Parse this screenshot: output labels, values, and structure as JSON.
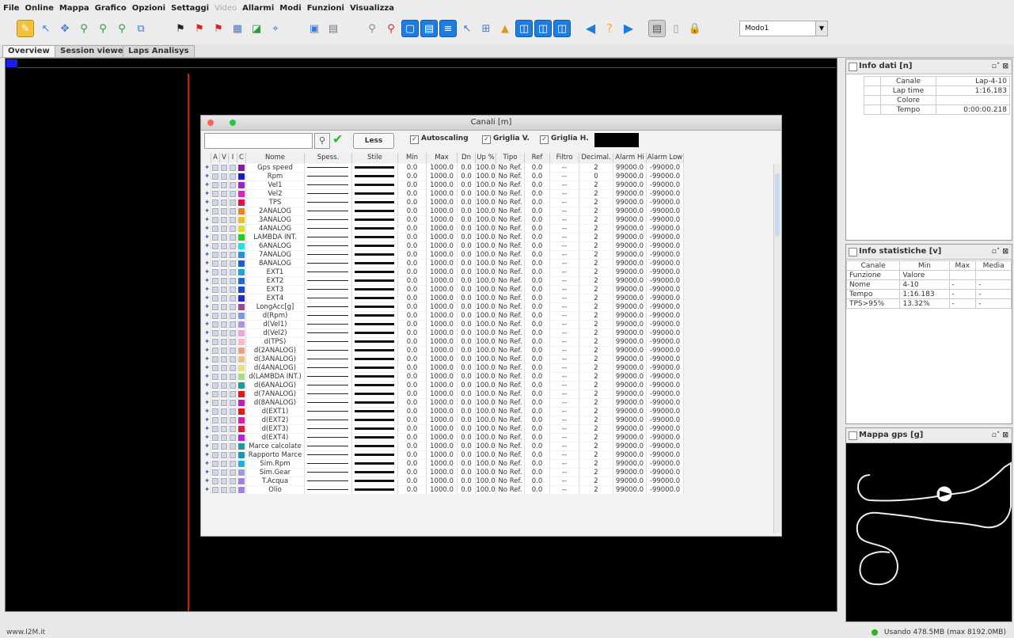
{
  "menu": [
    "File",
    "Online",
    "Mappa",
    "Grafico",
    "Opzioni",
    "Settaggi",
    "Video",
    "Allarmi",
    "Modi",
    "Funzioni",
    "Visualizza"
  ],
  "menu_disabled": [
    "Video"
  ],
  "toolbar": {
    "mode_value": "Modo1"
  },
  "tabs": [
    "Overview",
    "Session viewer",
    "Laps Analisys"
  ],
  "active_tab": "Overview",
  "status": {
    "website": "www.I2M.it",
    "memory": "Usando 478.5MB (max 8192.0MB)"
  },
  "info_dati": {
    "title": "Info dati [n]",
    "rows": [
      {
        "label": "Canale",
        "value": "Lap-4-10"
      },
      {
        "label": "Lap time",
        "value": "1:16.183"
      },
      {
        "label": "Colore",
        "value": ""
      },
      {
        "label": "Tempo",
        "value": "0:00:00.218"
      }
    ]
  },
  "info_stat": {
    "title": "Info statistiche [v]",
    "headers": [
      "Canale",
      "Min",
      "Max",
      "Media"
    ],
    "rows": [
      [
        "Funzione",
        "Valore",
        "",
        ""
      ],
      [
        "Nome",
        "4-10",
        "-",
        "-"
      ],
      [
        "Tempo",
        "1:16.183",
        "-",
        "-"
      ],
      [
        "TPS>95%",
        "13.32%",
        "-",
        "-"
      ]
    ]
  },
  "mappa_gps": {
    "title": "Mappa gps [g]"
  },
  "dialog": {
    "title": "Canali [m]",
    "less_label": "Less",
    "autoscaling": "Autoscaling",
    "griglia_v": "Griglia V.",
    "griglia_h": "Griglia H.",
    "headers": [
      "A",
      "V",
      "I",
      "C",
      "Nome",
      "Spess.",
      "Stile",
      "Min",
      "Max",
      "Dn %",
      "Up %",
      "Tipo",
      "Ref",
      "Filtro",
      "Decimal.",
      "Alarm Hi",
      "Alarm Low"
    ],
    "rows": [
      {
        "name": "Gps speed",
        "color": "#8a1a9a",
        "dec": "2"
      },
      {
        "name": "Rpm",
        "color": "#1a1acc",
        "dec": "0"
      },
      {
        "name": "Vel1",
        "color": "#a020d0",
        "dec": "2"
      },
      {
        "name": "Vel2",
        "color": "#e020c0",
        "dec": "2"
      },
      {
        "name": "TPS",
        "color": "#e0104a",
        "dec": "2"
      },
      {
        "name": "2ANALOG",
        "color": "#f08020",
        "dec": "2"
      },
      {
        "name": "3ANALOG",
        "color": "#f0c020",
        "dec": "2"
      },
      {
        "name": "4ANALOG",
        "color": "#d8e020",
        "dec": "2"
      },
      {
        "name": "LAMBDA INT.",
        "color": "#20d020",
        "dec": "2"
      },
      {
        "name": "6ANALOG",
        "color": "#20e0e0",
        "dec": "2"
      },
      {
        "name": "7ANALOG",
        "color": "#2090e0",
        "dec": "2"
      },
      {
        "name": "8ANALOG",
        "color": "#1a5ae0",
        "dec": "2"
      },
      {
        "name": "EXT1",
        "color": "#20a0e0",
        "dec": "2"
      },
      {
        "name": "EXT2",
        "color": "#1a70d8",
        "dec": "2"
      },
      {
        "name": "EXT3",
        "color": "#1a4ad0",
        "dec": "2"
      },
      {
        "name": "EXT4",
        "color": "#1a2ad0",
        "dec": "2"
      },
      {
        "name": "LongAcc[g]",
        "color": "#9a4a9a",
        "dec": "2"
      },
      {
        "name": "d(Rpm)",
        "color": "#7a9ae0",
        "dec": "2"
      },
      {
        "name": "d(Vel1)",
        "color": "#b090e0",
        "dec": "2"
      },
      {
        "name": "d(Vel2)",
        "color": "#f0a0e0",
        "dec": "2"
      },
      {
        "name": "d(TPS)",
        "color": "#f8b8c8",
        "dec": "2"
      },
      {
        "name": "d(2ANALOG)",
        "color": "#f0a080",
        "dec": "2"
      },
      {
        "name": "d(3ANALOG)",
        "color": "#f0c080",
        "dec": "2"
      },
      {
        "name": "d(4ANALOG)",
        "color": "#e8e080",
        "dec": "2"
      },
      {
        "name": "d(LAMBDA INT.)",
        "color": "#a0e080",
        "dec": "2"
      },
      {
        "name": "d(6ANALOG)",
        "color": "#1a9a9a",
        "dec": "2"
      },
      {
        "name": "d(7ANALOG)",
        "color": "#e01a1a",
        "dec": "2"
      },
      {
        "name": "d(8ANALOG)",
        "color": "#c01ac0",
        "dec": "2"
      },
      {
        "name": "d(EXT1)",
        "color": "#e01a1a",
        "dec": "2"
      },
      {
        "name": "d(EXT2)",
        "color": "#e01ab0",
        "dec": "2"
      },
      {
        "name": "d(EXT3)",
        "color": "#e01a3a",
        "dec": "2"
      },
      {
        "name": "d(EXT4)",
        "color": "#c01ae0",
        "dec": "2"
      },
      {
        "name": "Marce calcolate",
        "color": "#1a9a9a",
        "dec": "2"
      },
      {
        "name": "Rapporto Marce",
        "color": "#1a9aaa",
        "dec": "2"
      },
      {
        "name": "Sim.Rpm",
        "color": "#20b0e0",
        "dec": "2"
      },
      {
        "name": "Sim.Gear",
        "color": "#9a9ae0",
        "dec": "2"
      },
      {
        "name": "T.Acqua",
        "color": "#a080e0",
        "dec": "2"
      },
      {
        "name": "Olio",
        "color": "#a080e0",
        "dec": "2"
      }
    ],
    "row_defaults": {
      "min": "0.0",
      "max": "1000.0",
      "dn": "0.0",
      "up": "100.0",
      "tipo": "No Ref.",
      "ref": "0.0",
      "filtro": "--",
      "alarm_hi": "99000.0",
      "alarm_low": "-99000.0"
    }
  }
}
